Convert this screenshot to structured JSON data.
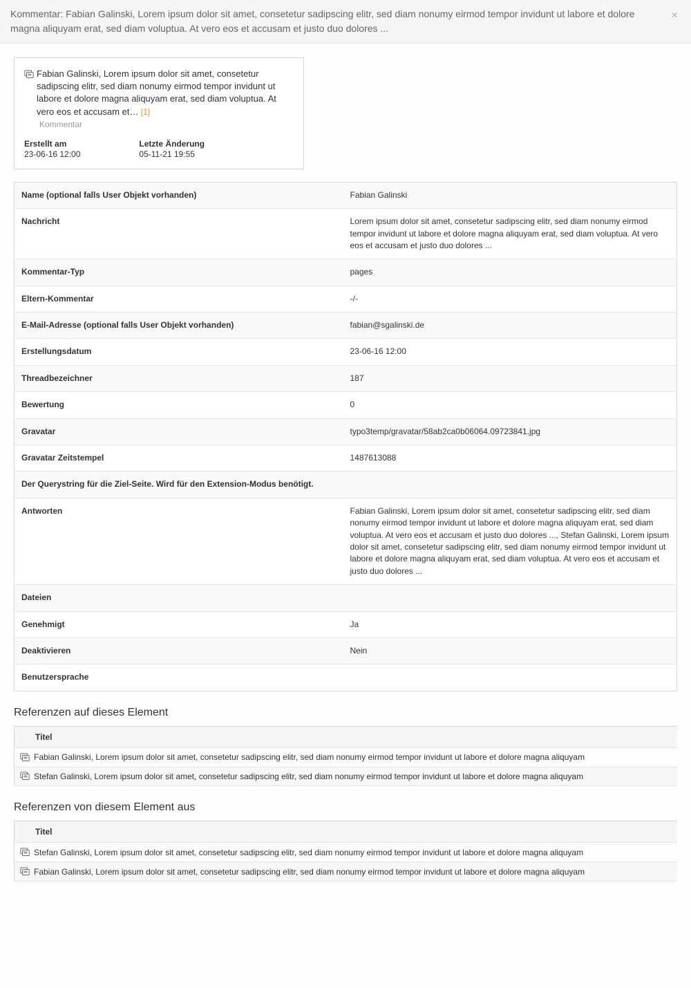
{
  "header": {
    "title": "Kommentar: Fabian Galinski, Lorem ipsum dolor sit amet, consetetur sadipscing elitr, sed diam nonumy eirmod tempor invidunt ut labore et dolore magna aliquyam erat, sed diam voluptua. At vero eos et accusam et justo duo dolores ..."
  },
  "card": {
    "text": "Fabian Galinski, Lorem ipsum dolor sit amet, consetetur sadipscing elitr, sed diam nonumy eirmod tempor invidunt ut labore et dolore magna aliquyam erat, sed diam voluptua. At vero eos et accusam et…",
    "link": " [1]",
    "type_label": "Kommentar",
    "created_label": "Erstellt am",
    "created_value": "23-06-16 12:00",
    "modified_label": "Letzte Änderung",
    "modified_value": "05-11-21 19:55"
  },
  "properties": [
    {
      "label": "Name (optional falls User Objekt vorhanden)",
      "value": "Fabian Galinski"
    },
    {
      "label": "Nachricht",
      "value": "Lorem ipsum dolor sit amet, consetetur sadipscing elitr, sed diam nonumy eirmod tempor invidunt ut labore et dolore magna aliquyam erat, sed diam voluptua. At vero eos et accusam et justo duo dolores ..."
    },
    {
      "label": "Kommentar-Typ",
      "value": "pages"
    },
    {
      "label": "Eltern-Kommentar",
      "value": "-/-"
    },
    {
      "label": "E-Mail-Adresse (optional falls User Objekt vorhanden)",
      "value": "fabian@sgalinski.de"
    },
    {
      "label": "Erstellungsdatum",
      "value": "23-06-16 12:00"
    },
    {
      "label": "Threadbezeichner",
      "value": "187"
    },
    {
      "label": "Bewertung",
      "value": "0"
    },
    {
      "label": "Gravatar",
      "value": "typo3temp/gravatar/58ab2ca0b06064.09723841.jpg"
    },
    {
      "label": "Gravatar Zeitstempel",
      "value": "1487613088"
    },
    {
      "label": "Der Querystring für die Ziel-Seite. Wird für den Extension-Modus benötigt.",
      "value": "",
      "full": true
    },
    {
      "label": "Antworten",
      "value": "Fabian Galinski, Lorem ipsum dolor sit amet, consetetur sadipscing elitr, sed diam nonumy eirmod tempor invidunt ut labore et dolore magna aliquyam erat, sed diam voluptua. At vero eos et accusam et justo duo dolores ..., Stefan Galinski, Lorem ipsum dolor sit amet, consetetur sadipscing elitr, sed diam nonumy eirmod tempor invidunt ut labore et dolore magna aliquyam erat, sed diam voluptua. At vero eos et accusam et justo duo dolores ..."
    },
    {
      "label": "Dateien",
      "value": "",
      "full": true
    },
    {
      "label": "Genehmigt",
      "value": "Ja"
    },
    {
      "label": "Deaktivieren",
      "value": "Nein"
    },
    {
      "label": "Benutzersprache",
      "value": "",
      "full": true
    }
  ],
  "refs_to": {
    "heading": "Referenzen auf dieses Element",
    "col": "Titel",
    "items": [
      "Fabian Galinski, Lorem ipsum dolor sit amet, consetetur sadipscing elitr, sed diam nonumy eirmod tempor invidunt ut labore et dolore magna aliquyam",
      "Stefan Galinski, Lorem ipsum dolor sit amet, consetetur sadipscing elitr, sed diam nonumy eirmod tempor invidunt ut labore et dolore magna aliquyam"
    ]
  },
  "refs_from": {
    "heading": "Referenzen von diesem Element aus",
    "col": "Titel",
    "items": [
      "Stefan Galinski, Lorem ipsum dolor sit amet, consetetur sadipscing elitr, sed diam nonumy eirmod tempor invidunt ut labore et dolore magna aliquyam",
      "Fabian Galinski, Lorem ipsum dolor sit amet, consetetur sadipscing elitr, sed diam nonumy eirmod tempor invidunt ut labore et dolore magna aliquyam"
    ]
  }
}
